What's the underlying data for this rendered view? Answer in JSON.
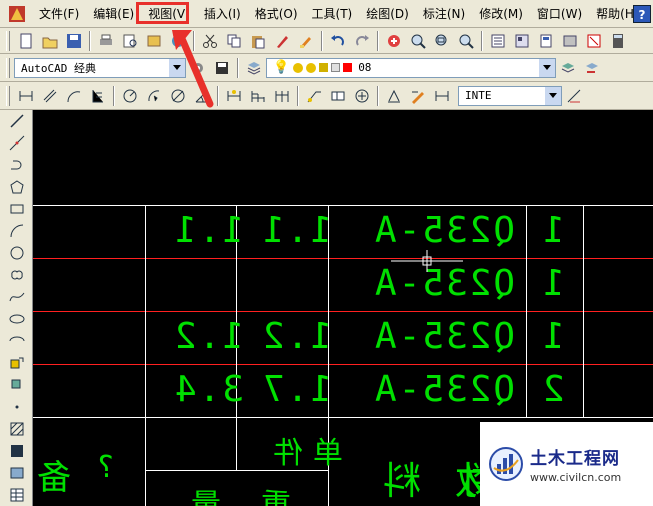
{
  "menubar": {
    "items": [
      {
        "id": "file",
        "label": "文件(F)"
      },
      {
        "id": "edit",
        "label": "编辑(E)"
      },
      {
        "id": "view",
        "label": "视图(V)"
      },
      {
        "id": "insert",
        "label": "插入(I)"
      },
      {
        "id": "format",
        "label": "格式(O)"
      },
      {
        "id": "tools",
        "label": "工具(T)"
      },
      {
        "id": "draw",
        "label": "绘图(D)"
      },
      {
        "id": "dimension",
        "label": "标注(N)"
      },
      {
        "id": "modify",
        "label": "修改(M)"
      },
      {
        "id": "window",
        "label": "窗口(W)"
      },
      {
        "id": "help",
        "label": "帮助(H)"
      }
    ],
    "help_icon": "?"
  },
  "toolbar2": {
    "workspace": "AutoCAD 经典",
    "layer": "08"
  },
  "toolbar3": {
    "dimstyle": "INTE"
  },
  "table": {
    "rows": [
      [
        "1.1",
        "1.1",
        "Q235-A",
        "1"
      ],
      [
        "",
        "",
        "Q235-A",
        "1"
      ],
      [
        "1.2",
        "1.2",
        "Q235-A",
        "1"
      ],
      [
        "3.4",
        "1.7",
        "Q235-A",
        "2"
      ]
    ],
    "bottom_texts": [
      "重量",
      "单件",
      "材料",
      "数",
      "?",
      "备"
    ]
  },
  "watermark": {
    "title": "土木工程网",
    "url": "www.civilcn.com"
  },
  "colors": {
    "highlight": "#e8302b",
    "cad_text": "#00e000",
    "cad_bg": "#000000",
    "red_line": "#ff0000"
  }
}
